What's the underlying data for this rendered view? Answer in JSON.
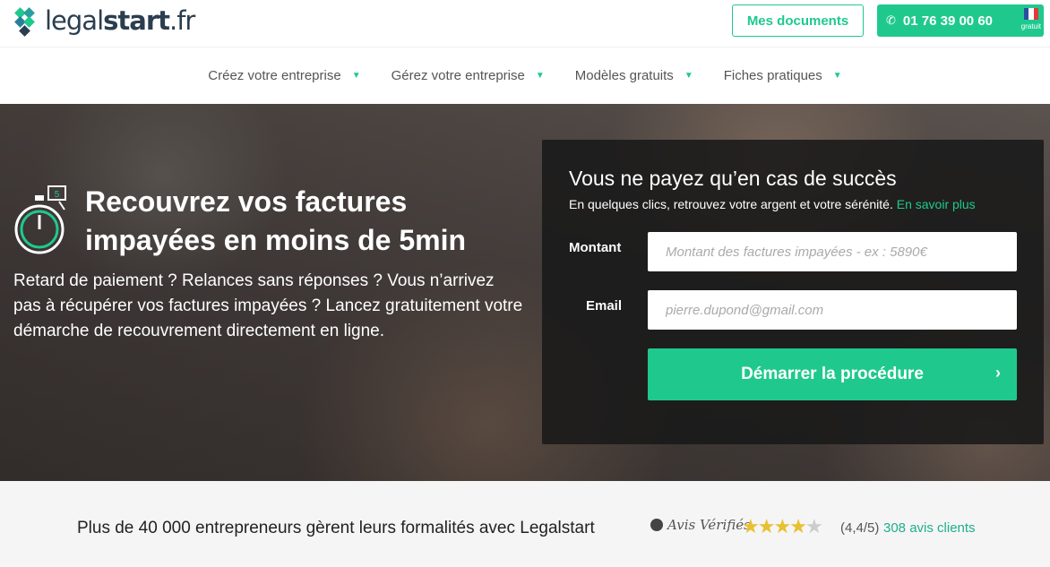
{
  "header": {
    "logo": {
      "light": "legal",
      "bold": "start",
      "tld": ".fr"
    },
    "docs_button": "Mes documents",
    "phone": "01 76 39 00 60",
    "phone_note": "gratuit",
    "phone_icon": "phone-icon"
  },
  "nav": {
    "items": [
      {
        "label": "Créez votre entreprise"
      },
      {
        "label": "Gérez votre entreprise"
      },
      {
        "label": "Modèles gratuits"
      },
      {
        "label": "Fiches pratiques"
      }
    ]
  },
  "hero": {
    "clock_number": "5",
    "title": "Recouvrez vos factures impayées en moins de 5min",
    "text": "Retard de paiement ? Relances sans réponses ? Vous n’arrivez pas à récupérer vos factures impayées ? Lancez gratuitement votre démarche de recouvrement directement en ligne."
  },
  "form": {
    "title": "Vous ne payez qu’en cas de succès",
    "subtitle": "En quelques clics, retrouvez votre argent et votre sérénité.",
    "learn_more": "En savoir plus",
    "amount_label": "Montant",
    "amount_placeholder": "Montant des factures impayées - ex : 5890€",
    "email_label": "Email",
    "email_placeholder": "pierre.dupond@gmail.com",
    "submit": "Démarrer la procédure",
    "submit_arrow": "›"
  },
  "trust": {
    "text": "Plus de 40 000 entrepreneurs gèrent leurs formalités avec Legalstart",
    "brand": "Avis Vérifiés",
    "rating": 4.4,
    "score": "(4,4/5)",
    "reviews": "308 avis clients"
  },
  "colors": {
    "accent": "#1fc98e",
    "navy": "#2b3e50"
  }
}
